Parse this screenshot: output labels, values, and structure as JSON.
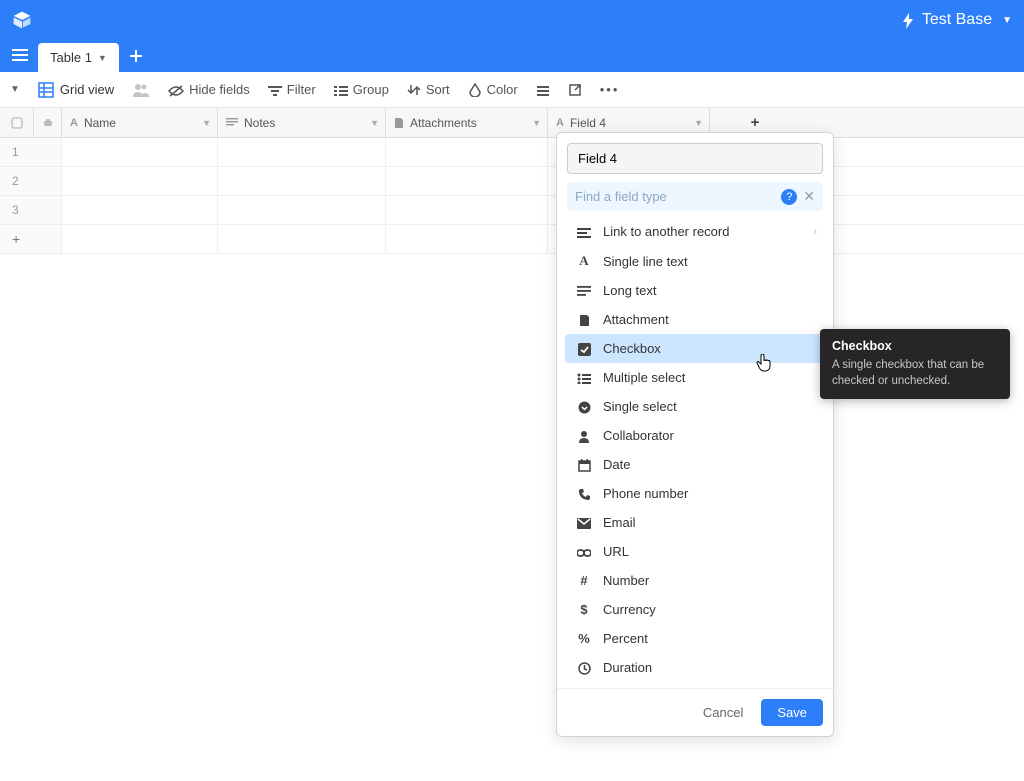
{
  "header": {
    "base_name": "Test Base"
  },
  "tabs": {
    "active": "Table 1"
  },
  "toolbar": {
    "gridview": "Grid view",
    "hide_fields": "Hide fields",
    "filter": "Filter",
    "group": "Group",
    "sort": "Sort",
    "color": "Color"
  },
  "columns": {
    "name": "Name",
    "notes": "Notes",
    "attachments": "Attachments",
    "field4": "Field 4"
  },
  "rows": [
    "1",
    "2",
    "3"
  ],
  "popup": {
    "field_name_value": "Field 4",
    "search_placeholder": "Find a field type",
    "cancel": "Cancel",
    "save": "Save",
    "types": [
      {
        "icon": "link",
        "label": "Link to another record",
        "chevron": true
      },
      {
        "icon": "A",
        "label": "Single line text"
      },
      {
        "icon": "longtext",
        "label": "Long text"
      },
      {
        "icon": "file",
        "label": "Attachment"
      },
      {
        "icon": "check",
        "label": "Checkbox",
        "hover": true
      },
      {
        "icon": "multiselect",
        "label": "Multiple select"
      },
      {
        "icon": "singleselect",
        "label": "Single select"
      },
      {
        "icon": "user",
        "label": "Collaborator"
      },
      {
        "icon": "calendar",
        "label": "Date"
      },
      {
        "icon": "phone",
        "label": "Phone number"
      },
      {
        "icon": "email",
        "label": "Email"
      },
      {
        "icon": "url",
        "label": "URL"
      },
      {
        "icon": "hash",
        "label": "Number"
      },
      {
        "icon": "dollar",
        "label": "Currency"
      },
      {
        "icon": "percent",
        "label": "Percent"
      },
      {
        "icon": "clock",
        "label": "Duration"
      }
    ]
  },
  "tooltip": {
    "title": "Checkbox",
    "body": "A single checkbox that can be checked or unchecked."
  }
}
